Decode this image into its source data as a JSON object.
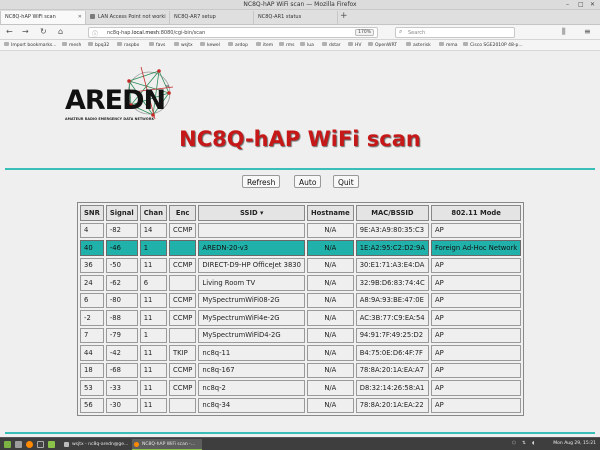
{
  "window": {
    "title": "NC8Q-hAP WiFi scan — Mozilla Firefox",
    "min": "–",
    "max": "□",
    "close": "✕"
  },
  "tabs": [
    {
      "label": "NC8Q-hAP WiFi scan",
      "active": true
    },
    {
      "label": "LAN Access Point not worki",
      "active": false
    },
    {
      "label": "NC8Q-AR7 setup",
      "active": false
    },
    {
      "label": "NC8Q-AR1 status",
      "active": false
    }
  ],
  "newtab": "+",
  "nav": {
    "back": "←",
    "forward": "→",
    "reload": "↻",
    "home": "⌂",
    "url_prefix": "nc8q-hap.",
    "url_host": "local.mesh",
    "url_suffix": ":8080/cgi-bin/scan",
    "zoom": "170%",
    "search_placeholder": "Search",
    "menu": "≡",
    "library": "⫼"
  },
  "bookmarks": [
    "Import bookmarks...",
    "mesh",
    "bpq32",
    "raspbx",
    "favs",
    "wsjtx",
    "kewel",
    "ardop",
    "item",
    "rms",
    "lua",
    "dstar",
    "HV",
    "OpenWRT",
    "asterisk",
    "mma",
    "Cisco SGE2010P 48-p..."
  ],
  "logo": {
    "word": "AREDN",
    "tm": "™",
    "subtitle": "AMATEUR RADIO EMERGENCY DATA NETWORK"
  },
  "page_title": "NC8Q-hAP WiFi scan",
  "buttons": {
    "refresh": "Refresh",
    "auto": "Auto",
    "quit": "Quit"
  },
  "table": {
    "headers": [
      "SNR",
      "Signal",
      "Chan",
      "Enc",
      "SSID ▾",
      "Hostname",
      "MAC/BSSID",
      "802.11 Mode"
    ],
    "rows": [
      [
        "4",
        "-82",
        "14",
        "CCMP",
        "",
        "N/A",
        "9E:A3:A9:80:35:C3",
        "AP"
      ],
      [
        "40",
        "-46",
        "1",
        "",
        "AREDN-20-v3",
        "N/A",
        "1E:A2:95:C2:D2:9A",
        "Foreign Ad-Hoc Network"
      ],
      [
        "36",
        "-50",
        "11",
        "CCMP",
        "DIRECT-D9-HP OfficeJet 3830",
        "N/A",
        "30:E1:71:A3:E4:DA",
        "AP"
      ],
      [
        "24",
        "-62",
        "6",
        "",
        "Living Room TV",
        "N/A",
        "32:9B:D6:83:74:4C",
        "AP"
      ],
      [
        "6",
        "-80",
        "11",
        "CCMP",
        "MySpectrumWiFi08-2G",
        "N/A",
        "A8:9A:93:BE:47:0E",
        "AP"
      ],
      [
        "-2",
        "-88",
        "11",
        "CCMP",
        "MySpectrumWiFi4e-2G",
        "N/A",
        "AC:3B:77:C9:EA:54",
        "AP"
      ],
      [
        "7",
        "-79",
        "1",
        "",
        "MySpectrumWiFiD4-2G",
        "N/A",
        "94:91:7F:49:25:D2",
        "AP"
      ],
      [
        "44",
        "-42",
        "11",
        "TKIP",
        "nc8q-11",
        "N/A",
        "B4:75:0E:D6:4F:7F",
        "AP"
      ],
      [
        "18",
        "-68",
        "11",
        "CCMP",
        "nc8q-167",
        "N/A",
        "78:8A:20:1A:EA:A7",
        "AP"
      ],
      [
        "53",
        "-33",
        "11",
        "CCMP",
        "nc8q-2",
        "N/A",
        "D8:32:14:26:58:A1",
        "AP"
      ],
      [
        "56",
        "-30",
        "11",
        "",
        "nc8q-34",
        "N/A",
        "78:8A:20:1A:EA:22",
        "AP"
      ]
    ],
    "highlight_row": 1,
    "highlight_color": "#20b2aa"
  },
  "colors": {
    "title": "#c61818",
    "rule": "#3bbdb8"
  },
  "taskbar": {
    "windows": [
      {
        "label": "wsjtx - nc8q-aredn@ge...",
        "active": false
      },
      {
        "label": "NC8Q-hAP WiFi scan -...",
        "active": true
      }
    ],
    "clock": "Mon Aug 29, 15:21"
  }
}
